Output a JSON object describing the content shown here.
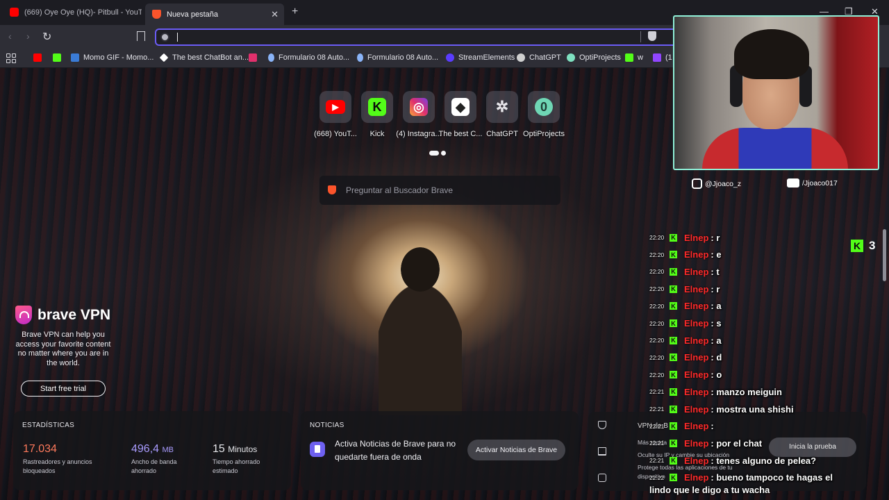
{
  "tabs": [
    {
      "title": "(669) Oye Oye (HQ)- Pitbull - YouTube",
      "active": false,
      "favicon": "youtube-icon"
    },
    {
      "title": "Nueva pestaña",
      "active": true,
      "favicon": "brave-icon",
      "close": "✕"
    }
  ],
  "window": {
    "new_tab": "+",
    "minimize": "—",
    "maximize": "❐",
    "close": "✕"
  },
  "toolbar": {
    "back": "‹",
    "forward": "›",
    "reload": "↻",
    "omnibox_value": ""
  },
  "bookmarks": [
    {
      "label": "",
      "favicon": "youtube-icon",
      "color": "#ff0000"
    },
    {
      "label": "",
      "favicon": "kick-icon",
      "color": "#53fc18"
    },
    {
      "label": "Momo GIF - Momo...",
      "favicon": "gif-icon",
      "color": "#3a7bd5"
    },
    {
      "label": "The best ChatBot an...",
      "favicon": "chatbot-icon",
      "color": "#ffffff"
    },
    {
      "label": "",
      "favicon": "instagram-icon",
      "color": "#e1306c"
    },
    {
      "label": "Formulario 08 Auto...",
      "favicon": "form-icon",
      "color": "#8ab4f8"
    },
    {
      "label": "Formulario 08 Auto...",
      "favicon": "form-icon",
      "color": "#8ab4f8"
    },
    {
      "label": "StreamElements",
      "favicon": "streamelements-icon",
      "color": "#5a3cff"
    },
    {
      "label": "ChatGPT",
      "favicon": "chatgpt-icon",
      "color": "#d0d0d0"
    },
    {
      "label": "OptiProjects",
      "favicon": "optiprojects-icon",
      "color": "#7ee0c0"
    },
    {
      "label": "w",
      "favicon": "w-icon",
      "color": "#53fc18"
    },
    {
      "label": "(1",
      "favicon": "twitch-icon",
      "color": "#9146ff"
    }
  ],
  "top_sites": [
    {
      "label": "(668) YouT...",
      "icon": "youtube-icon",
      "color": "#ff0000",
      "glyph": "▶"
    },
    {
      "label": "Kick",
      "icon": "kick-icon",
      "color": "#53fc18",
      "glyph": "K"
    },
    {
      "label": "(4) Instagra...",
      "icon": "instagram-icon",
      "color": "#e1306c",
      "glyph": "◎"
    },
    {
      "label": "The best C...",
      "icon": "chatbot-icon",
      "color": "#ffffff",
      "glyph": "◆"
    },
    {
      "label": "ChatGPT",
      "icon": "chatgpt-icon",
      "color": "#9a9aa0",
      "glyph": "✲"
    },
    {
      "label": "OptiProjects",
      "icon": "optiprojects-icon",
      "color": "#6fd6b4",
      "glyph": "0"
    }
  ],
  "search": {
    "placeholder": "Preguntar al Buscador Brave"
  },
  "vpn": {
    "title": "brave VPN",
    "description": "Brave VPN can help you access your favorite content no matter where you are in the world.",
    "button": "Start free trial"
  },
  "stats": {
    "heading": "ESTADÍSTICAS",
    "trackers": {
      "value": "17.034",
      "label": "Rastreadores y anuncios bloqueados",
      "color": "#ff7a5c"
    },
    "bandwidth": {
      "value": "496,4",
      "unit": "MB",
      "label": "Ancho de banda ahorrado",
      "color": "#a99cff"
    },
    "time": {
      "value": "15",
      "unit": "Minutos",
      "label": "Tiempo ahorrado estimado",
      "color": "#ffffff"
    }
  },
  "news": {
    "heading": "NOTICIAS",
    "text": "Activa Noticias de Brave para no quedarte fuera de onda",
    "button": "Activar Noticias de Brave"
  },
  "vpn_card": {
    "title": "VPN de B",
    "line1": "Más rápida",
    "line2": "Oculte su IP y cambie su ubicación",
    "line3": "Protege todas las aplicaciones de tu",
    "line4": "dispositivo",
    "button": "Inicia la prueba"
  },
  "stream": {
    "instagram": "@Jjoaco_z",
    "youtube": "/Jjoaco017",
    "viewers": "3",
    "chat_username": "Elnep",
    "chat": [
      {
        "time": "22:20",
        "msg": ": r"
      },
      {
        "time": "22:20",
        "msg": ": e"
      },
      {
        "time": "22:20",
        "msg": ": t"
      },
      {
        "time": "22:20",
        "msg": ": r"
      },
      {
        "time": "22:20",
        "msg": ": a"
      },
      {
        "time": "22:20",
        "msg": ": s"
      },
      {
        "time": "22:20",
        "msg": ": a"
      },
      {
        "time": "22:20",
        "msg": ": d"
      },
      {
        "time": "22:20",
        "msg": ": o"
      },
      {
        "time": "22:21",
        "msg": ": manzo meiguin"
      },
      {
        "time": "22:21",
        "msg": ": mostra una shishi"
      },
      {
        "time": "22:21",
        "msg": ":"
      },
      {
        "time": "22:21",
        "msg": ": por el chat"
      },
      {
        "time": "22:21",
        "msg": ": tenes alguno de pelea?"
      },
      {
        "time": "22:22",
        "msg": ": bueno tampoco te hagas el"
      }
    ],
    "chat_continuation": "lindo que le digo a tu wacha"
  }
}
